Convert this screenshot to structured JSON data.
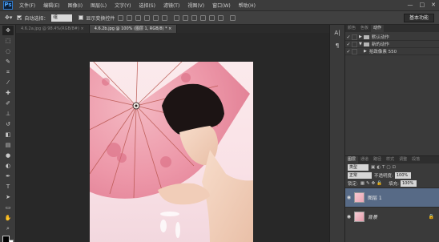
{
  "app": {
    "logo": "Ps"
  },
  "menu": {
    "items": [
      "文件(F)",
      "编辑(E)",
      "图像(I)",
      "图层(L)",
      "文字(Y)",
      "选择(S)",
      "滤镜(T)",
      "视图(V)",
      "窗口(W)",
      "帮助(H)"
    ],
    "window_controls": [
      "—",
      "□",
      "✕"
    ]
  },
  "options": {
    "auto_select_label": "自动选择：",
    "auto_select_value": "组",
    "show_transform_label": "显示变换控件",
    "workspace": "基本功能"
  },
  "tabs": [
    {
      "label": "4.6.2a.jpg @ 98.4%(RGB/8#) ×"
    },
    {
      "label": "4.6.2b.jpg @ 100% (图层 1, RGB/8) * ×"
    }
  ],
  "right_top_tabs": [
    "颜色",
    "色板",
    "动作"
  ],
  "actions": {
    "rows": [
      {
        "label": "默认动作"
      },
      {
        "label": "新的动作"
      },
      {
        "label": "拾政像素 550"
      }
    ]
  },
  "layers_panel": {
    "tabs": [
      "图层",
      "通道",
      "路径",
      "样式",
      "调整",
      "段落"
    ],
    "kind_label": "类型",
    "blend_mode": "正常",
    "opacity_label": "不透明度:",
    "opacity_value": "100%",
    "lock_label": "锁定:",
    "fill_label": "填充:",
    "fill_value": "100%",
    "layers": [
      {
        "name": "图层 1",
        "selected": true
      },
      {
        "name": "背景",
        "selected": false
      }
    ]
  },
  "colors": {
    "ps_blue": "#4ea7ff",
    "selected_layer": "#576a86",
    "umbrella": "#e8879a"
  }
}
